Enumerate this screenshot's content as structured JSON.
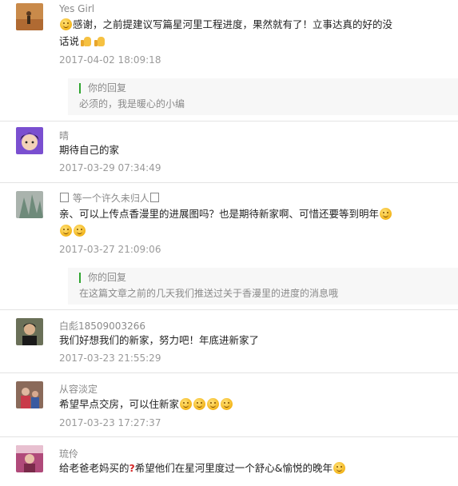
{
  "comments": [
    {
      "nickname": "Yes Girl",
      "text_a": "感谢，之前提建议写篇星河里工程进度，果然就有了！立事达真的好的没",
      "text_b": "话说",
      "time": "2017-04-02 18:09:18",
      "reply": {
        "label": "你的回复",
        "text": "必须的，我是暖心的小编"
      }
    },
    {
      "nickname": "晴",
      "text_a": "期待自己的家",
      "time": "2017-03-29 07:34:49"
    },
    {
      "nickname": "等一个许久未归人",
      "text_a": "亲、可以上传点香漫里的进展图吗？也是期待新家啊、可惜还要等到明年",
      "time": "2017-03-27 21:09:06",
      "reply": {
        "label": "你的回复",
        "text": "在这篇文章之前的几天我们推送过关于香漫里的进度的消息哦"
      }
    },
    {
      "nickname": "白彪18509003266",
      "text_a": "我们好想我们的新家，努力吧！年底进新家了",
      "time": "2017-03-23 21:55:29"
    },
    {
      "nickname": "从容淡定",
      "text_a": "希望早点交房，可以住新家",
      "time": "2017-03-23 17:27:37"
    },
    {
      "nickname": "琉伶",
      "text_a": "给老爸老妈买的",
      "text_b": "希望他们在星河里度过一个舒心&愉悦的晚年"
    }
  ]
}
